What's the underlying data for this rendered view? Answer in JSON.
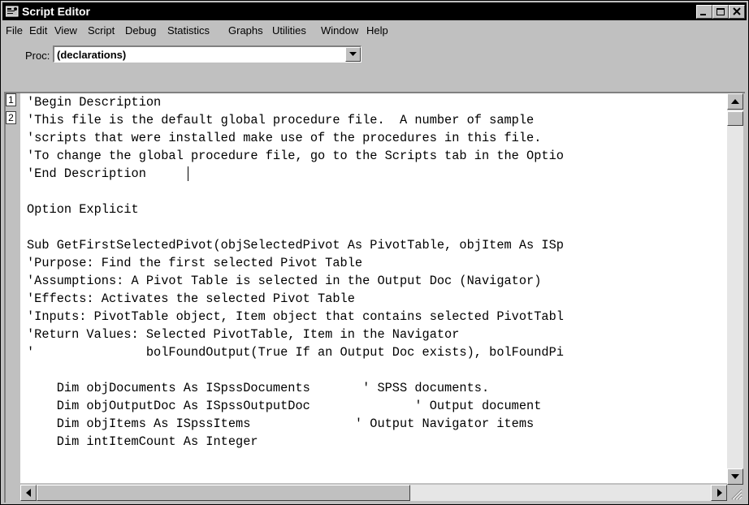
{
  "window": {
    "title": "Script Editor",
    "controls": [
      "minimize",
      "restore",
      "close"
    ]
  },
  "menu": {
    "items": [
      "File",
      "Edit",
      "View",
      "Script",
      "Debug",
      "Statistics",
      "Graphs",
      "Utilities",
      "Window",
      "Help"
    ]
  },
  "proc": {
    "label": "Proc:",
    "value": "(declarations)"
  },
  "gutter": {
    "markers": [
      "1",
      "2"
    ]
  },
  "code": {
    "lines": [
      "'Begin Description",
      "'This file is the default global procedure file.  A number of sample",
      "'scripts that were installed make use of the procedures in this file.",
      "'To change the global procedure file, go to the Scripts tab in the Optio",
      "'End Description",
      "",
      "Option Explicit",
      "",
      "Sub GetFirstSelectedPivot(objSelectedPivot As PivotTable, objItem As ISp",
      "'Purpose: Find the first selected Pivot Table",
      "'Assumptions: A Pivot Table is selected in the Output Doc (Navigator)",
      "'Effects: Activates the selected Pivot Table",
      "'Inputs: PivotTable object, Item object that contains selected PivotTabl",
      "'Return Values: Selected PivotTable, Item in the Navigator",
      "'               bolFoundOutput(True If an Output Doc exists), bolFoundPi",
      "",
      "    Dim objDocuments As ISpssDocuments       ' SPSS documents.",
      "    Dim objOutputDoc As ISpssOutputDoc              ' Output document",
      "    Dim objItems As ISpssItems              ' Output Navigator items",
      "    Dim intItemCount As Integer"
    ]
  },
  "colors": {
    "title_bar": "#000000",
    "chrome": "#c0c0c0",
    "editor_background": "#ffffff"
  }
}
